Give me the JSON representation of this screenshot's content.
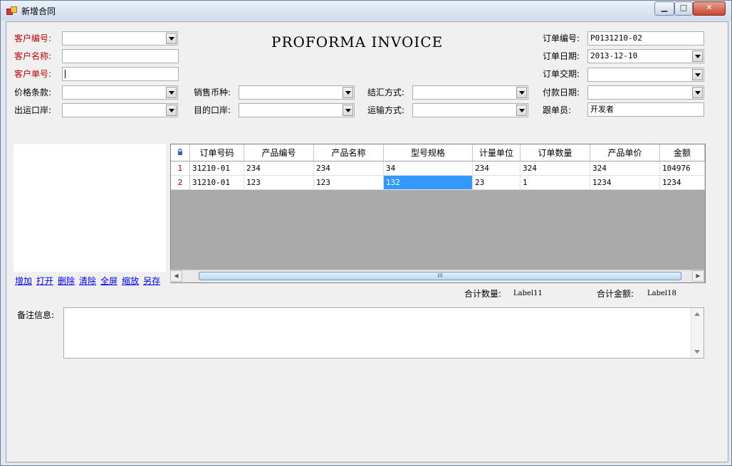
{
  "window": {
    "title": "新增合同",
    "controls": {
      "minimize": "▁",
      "maximize": "□",
      "close": "✕"
    }
  },
  "form": {
    "heading": "PROFORMA INVOICE",
    "customer_code_label": "客户编号:",
    "customer_name_label": "客户名称:",
    "customer_order_label": "客户单号:",
    "price_terms_label": "价格条款:",
    "sales_currency_label": "销售币种:",
    "settlement_label": "结汇方式:",
    "payment_date_label": "付款日期:",
    "port_load_label": "出运口岸:",
    "destination_port_label": "目的口岸:",
    "transport_label": "运输方式:",
    "follower_label": "跟单员:",
    "order_no_label": "订单编号:",
    "order_no_value": "P0131210-02",
    "order_date_label": "订单日期:",
    "order_date_value": "2013-12-10",
    "delivery_date_label": "订单交期:",
    "follower_value": "开发者"
  },
  "image_links": [
    "增加",
    "打开",
    "删除",
    "清除",
    "全屏",
    "缩放",
    "另存"
  ],
  "grid": {
    "columns": [
      "订单号码",
      "产品编号",
      "产品名称",
      "型号规格",
      "计量单位",
      "订单数量",
      "产品单价",
      "金额"
    ],
    "rows": [
      {
        "num": "1",
        "cells": [
          "31210-01",
          "234",
          "234",
          "34",
          "234",
          "324",
          "324",
          "104976"
        ]
      },
      {
        "num": "2",
        "cells": [
          "31210-01",
          "123",
          "123",
          "132",
          "23",
          "1",
          "1234",
          "1234"
        ]
      }
    ],
    "scroll_thumb": "III"
  },
  "totals": {
    "qty_label": "合计数量:",
    "qty_value": "Label11",
    "amount_label": "合计金额:",
    "amount_value": "Label18"
  },
  "notes": {
    "label": "备注信息:"
  },
  "colors": {
    "required_label": "#c00000",
    "link": "#0000ff",
    "selection": "#3399ff"
  },
  "icons": {
    "app": "app-icon",
    "lock": "lock-icon"
  }
}
